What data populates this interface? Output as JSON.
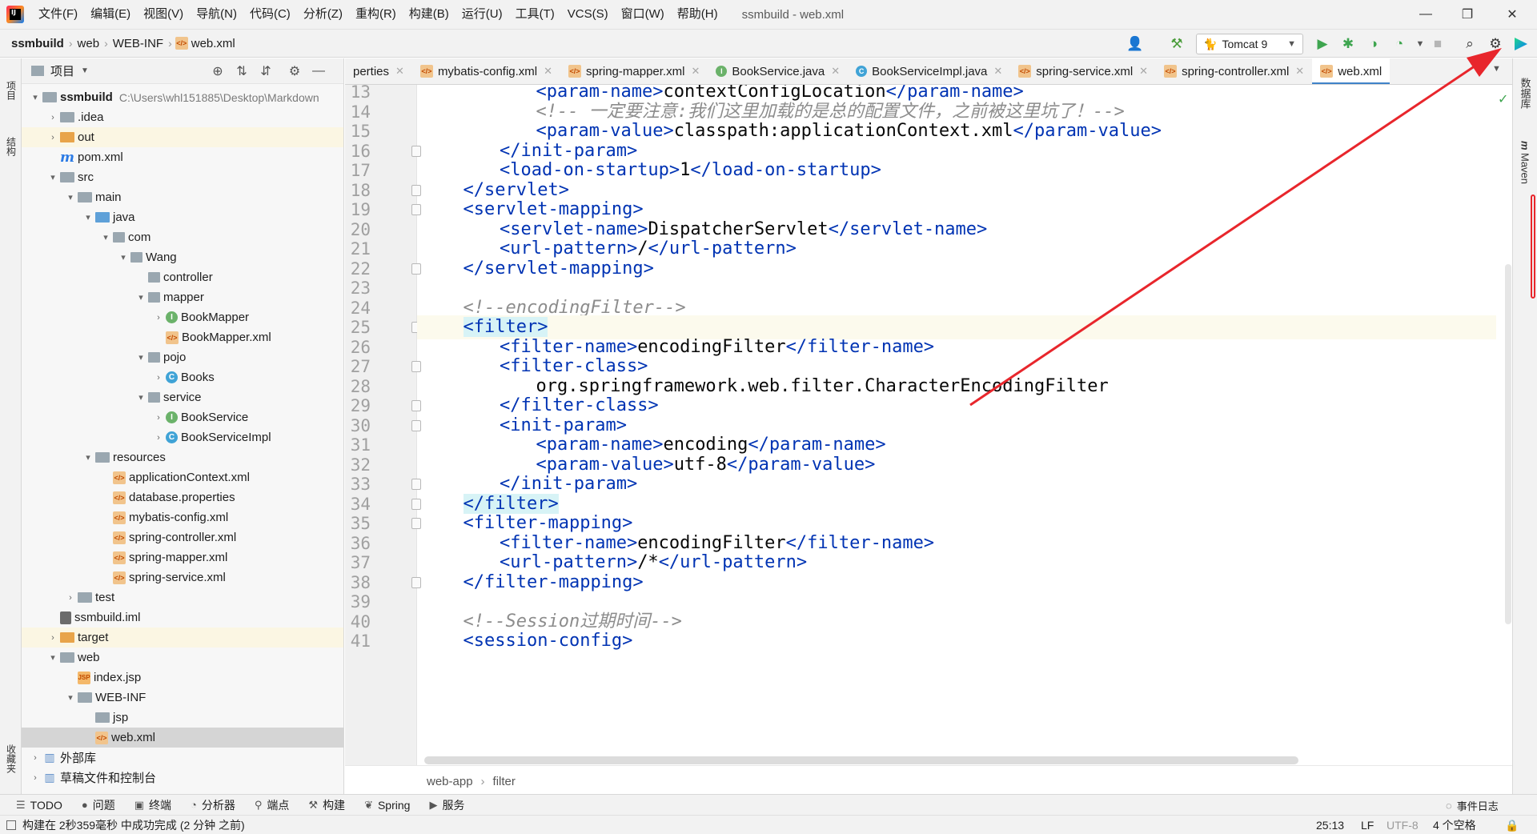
{
  "menu": [
    "文件(F)",
    "编辑(E)",
    "视图(V)",
    "导航(N)",
    "代码(C)",
    "分析(Z)",
    "重构(R)",
    "构建(B)",
    "运行(U)",
    "工具(T)",
    "VCS(S)",
    "窗口(W)",
    "帮助(H)"
  ],
  "window_title": "ssmbuild - web.xml",
  "breadcrumb": [
    "ssmbuild",
    "web",
    "WEB-INF",
    "web.xml"
  ],
  "run_config": "Tomcat 9",
  "left_strip": {
    "project": "项目",
    "structure": "结构",
    "favorites": "收藏夹"
  },
  "right_strip": {
    "database": "数据库",
    "maven": "Maven"
  },
  "project_panel": {
    "title": "项目"
  },
  "tree": [
    {
      "label": "ssmbuild",
      "sub": "C:\\Users\\whl151885\\Desktop\\Markdown",
      "icon": "folder",
      "arrow": "▾",
      "bold": true
    },
    {
      "label": ".idea",
      "icon": "folder",
      "arrow": "›"
    },
    {
      "label": "out",
      "icon": "folder-y",
      "arrow": "›",
      "hl": true
    },
    {
      "label": "pom.xml",
      "icon": "mvn",
      "arrow": ""
    },
    {
      "label": "src",
      "icon": "folder",
      "arrow": "▾"
    },
    {
      "label": "main",
      "icon": "folder",
      "arrow": "▾"
    },
    {
      "label": "java",
      "icon": "folder-b",
      "arrow": "▾"
    },
    {
      "label": "com",
      "icon": "pkg",
      "arrow": "▾"
    },
    {
      "label": "Wang",
      "icon": "pkg",
      "arrow": "▾"
    },
    {
      "label": "controller",
      "icon": "pkg",
      "arrow": ""
    },
    {
      "label": "mapper",
      "icon": "pkg",
      "arrow": "▾"
    },
    {
      "label": "BookMapper",
      "icon": "iface",
      "arrow": "›"
    },
    {
      "label": "BookMapper.xml",
      "icon": "xml",
      "arrow": ""
    },
    {
      "label": "pojo",
      "icon": "pkg",
      "arrow": "▾"
    },
    {
      "label": "Books",
      "icon": "cls",
      "arrow": "›"
    },
    {
      "label": "service",
      "icon": "pkg",
      "arrow": "▾"
    },
    {
      "label": "BookService",
      "icon": "iface",
      "arrow": "›"
    },
    {
      "label": "BookServiceImpl",
      "icon": "cls",
      "arrow": "›"
    },
    {
      "label": "resources",
      "icon": "folder",
      "arrow": "▾"
    },
    {
      "label": "applicationContext.xml",
      "icon": "xml",
      "arrow": ""
    },
    {
      "label": "database.properties",
      "icon": "xml",
      "arrow": ""
    },
    {
      "label": "mybatis-config.xml",
      "icon": "xml",
      "arrow": ""
    },
    {
      "label": "spring-controller.xml",
      "icon": "xml",
      "arrow": ""
    },
    {
      "label": "spring-mapper.xml",
      "icon": "xml",
      "arrow": ""
    },
    {
      "label": "spring-service.xml",
      "icon": "xml",
      "arrow": ""
    },
    {
      "label": "test",
      "icon": "folder",
      "arrow": "›"
    },
    {
      "label": "ssmbuild.iml",
      "icon": "iml",
      "arrow": ""
    },
    {
      "label": "target",
      "icon": "folder-y",
      "arrow": "›",
      "hl": true
    },
    {
      "label": "web",
      "icon": "folder",
      "arrow": "▾"
    },
    {
      "label": "index.jsp",
      "icon": "jsp",
      "arrow": ""
    },
    {
      "label": "WEB-INF",
      "icon": "folder",
      "arrow": "▾"
    },
    {
      "label": "jsp",
      "icon": "folder",
      "arrow": ""
    },
    {
      "label": "web.xml",
      "icon": "xml",
      "arrow": "",
      "selected": true
    },
    {
      "label": "外部库",
      "icon": "lib",
      "arrow": "›"
    },
    {
      "label": "草稿文件和控制台",
      "icon": "lib",
      "arrow": "›"
    }
  ],
  "tabs": [
    {
      "label": "perties",
      "icon": "none"
    },
    {
      "label": "mybatis-config.xml",
      "icon": "xml"
    },
    {
      "label": "spring-mapper.xml",
      "icon": "xml"
    },
    {
      "label": "BookService.java",
      "icon": "iface"
    },
    {
      "label": "BookServiceImpl.java",
      "icon": "cls"
    },
    {
      "label": "spring-service.xml",
      "icon": "xml"
    },
    {
      "label": "spring-controller.xml",
      "icon": "xml"
    },
    {
      "label": "web.xml",
      "icon": "xml",
      "active": true
    }
  ],
  "code": [
    {
      "n": 13,
      "indent": 3,
      "tokens": [
        [
          "tag",
          "<param-name>"
        ],
        [
          "text",
          "contextConfigLocation"
        ],
        [
          "tag",
          "</param-name>"
        ]
      ]
    },
    {
      "n": 14,
      "indent": 3,
      "tokens": [
        [
          "comment",
          "<!-- 一定要注意:我们这里加载的是总的配置文件，之前被这里坑了！-->"
        ]
      ]
    },
    {
      "n": 15,
      "indent": 3,
      "tokens": [
        [
          "tag",
          "<param-value>"
        ],
        [
          "text",
          "classpath:applicationContext.xml"
        ],
        [
          "tag",
          "</param-value>"
        ]
      ]
    },
    {
      "n": 16,
      "indent": 2,
      "tokens": [
        [
          "tag",
          "</init-param>"
        ]
      ]
    },
    {
      "n": 17,
      "indent": 2,
      "tokens": [
        [
          "tag",
          "<load-on-startup>"
        ],
        [
          "text",
          "1"
        ],
        [
          "tag",
          "</load-on-startup>"
        ]
      ]
    },
    {
      "n": 18,
      "indent": 1,
      "tokens": [
        [
          "tag",
          "</servlet>"
        ]
      ]
    },
    {
      "n": 19,
      "indent": 1,
      "tokens": [
        [
          "tag",
          "<servlet-mapping>"
        ]
      ]
    },
    {
      "n": 20,
      "indent": 2,
      "tokens": [
        [
          "tag",
          "<servlet-name>"
        ],
        [
          "text",
          "DispatcherServlet"
        ],
        [
          "tag",
          "</servlet-name>"
        ]
      ]
    },
    {
      "n": 21,
      "indent": 2,
      "tokens": [
        [
          "tag",
          "<url-pattern>"
        ],
        [
          "text",
          "/"
        ],
        [
          "tag",
          "</url-pattern>"
        ]
      ]
    },
    {
      "n": 22,
      "indent": 1,
      "tokens": [
        [
          "tag",
          "</servlet-mapping>"
        ]
      ]
    },
    {
      "n": 23,
      "indent": 0,
      "tokens": []
    },
    {
      "n": 24,
      "indent": 1,
      "tokens": [
        [
          "comment",
          "<!--encodingFilter-->"
        ]
      ]
    },
    {
      "n": 25,
      "indent": 1,
      "tokens": [
        [
          "hl",
          "<filter>"
        ]
      ],
      "current": true
    },
    {
      "n": 26,
      "indent": 2,
      "tokens": [
        [
          "tag",
          "<filter-name>"
        ],
        [
          "text",
          "encodingFilter"
        ],
        [
          "tag",
          "</filter-name>"
        ]
      ]
    },
    {
      "n": 27,
      "indent": 2,
      "tokens": [
        [
          "tag",
          "<filter-class>"
        ]
      ]
    },
    {
      "n": 28,
      "indent": 3,
      "tokens": [
        [
          "text",
          "org.springframework.web.filter.CharacterEncodingFilter"
        ]
      ]
    },
    {
      "n": 29,
      "indent": 2,
      "tokens": [
        [
          "tag",
          "</filter-class>"
        ]
      ]
    },
    {
      "n": 30,
      "indent": 2,
      "tokens": [
        [
          "tag",
          "<init-param>"
        ]
      ]
    },
    {
      "n": 31,
      "indent": 3,
      "tokens": [
        [
          "tag",
          "<param-name>"
        ],
        [
          "text",
          "encoding"
        ],
        [
          "tag",
          "</param-name>"
        ]
      ]
    },
    {
      "n": 32,
      "indent": 3,
      "tokens": [
        [
          "tag",
          "<param-value>"
        ],
        [
          "text",
          "utf-8"
        ],
        [
          "tag",
          "</param-value>"
        ]
      ]
    },
    {
      "n": 33,
      "indent": 2,
      "tokens": [
        [
          "tag",
          "</init-param>"
        ]
      ]
    },
    {
      "n": 34,
      "indent": 1,
      "tokens": [
        [
          "hl",
          "</filter>"
        ]
      ]
    },
    {
      "n": 35,
      "indent": 1,
      "tokens": [
        [
          "tag",
          "<filter-mapping>"
        ]
      ]
    },
    {
      "n": 36,
      "indent": 2,
      "tokens": [
        [
          "tag",
          "<filter-name>"
        ],
        [
          "text",
          "encodingFilter"
        ],
        [
          "tag",
          "</filter-name>"
        ]
      ]
    },
    {
      "n": 37,
      "indent": 2,
      "tokens": [
        [
          "tag",
          "<url-pattern>"
        ],
        [
          "text",
          "/*"
        ],
        [
          "tag",
          "</url-pattern>"
        ]
      ]
    },
    {
      "n": 38,
      "indent": 1,
      "tokens": [
        [
          "tag",
          "</filter-mapping>"
        ]
      ]
    },
    {
      "n": 39,
      "indent": 0,
      "tokens": []
    },
    {
      "n": 40,
      "indent": 1,
      "tokens": [
        [
          "comment",
          "<!--Session过期时间-->"
        ]
      ]
    },
    {
      "n": 41,
      "indent": 1,
      "tokens": [
        [
          "tag",
          "<session-config>"
        ]
      ]
    }
  ],
  "editor_breadcrumb": [
    "web-app",
    "filter"
  ],
  "bottom_tools": [
    {
      "label": "TODO",
      "icon": "☰"
    },
    {
      "label": "问题",
      "icon": "●"
    },
    {
      "label": "终端",
      "icon": "▣"
    },
    {
      "label": "分析器",
      "icon": "◔"
    },
    {
      "label": "端点",
      "icon": "⚲"
    },
    {
      "label": "构建",
      "icon": "⚒"
    },
    {
      "label": "Spring",
      "icon": "❦"
    },
    {
      "label": "服务",
      "icon": "▶"
    }
  ],
  "event_log": "事件日志",
  "status": {
    "message": "构建在 2秒359毫秒 中成功完成 (2 分钟 之前)",
    "position": "25:13",
    "line_sep": "LF",
    "encoding": "UTF-8",
    "indent": "4 个空格"
  },
  "colors": {
    "accent": "#4083c9",
    "annotation_arrow": "#e8262c",
    "tag": "#0033b3",
    "comment": "#8c8c8c"
  }
}
